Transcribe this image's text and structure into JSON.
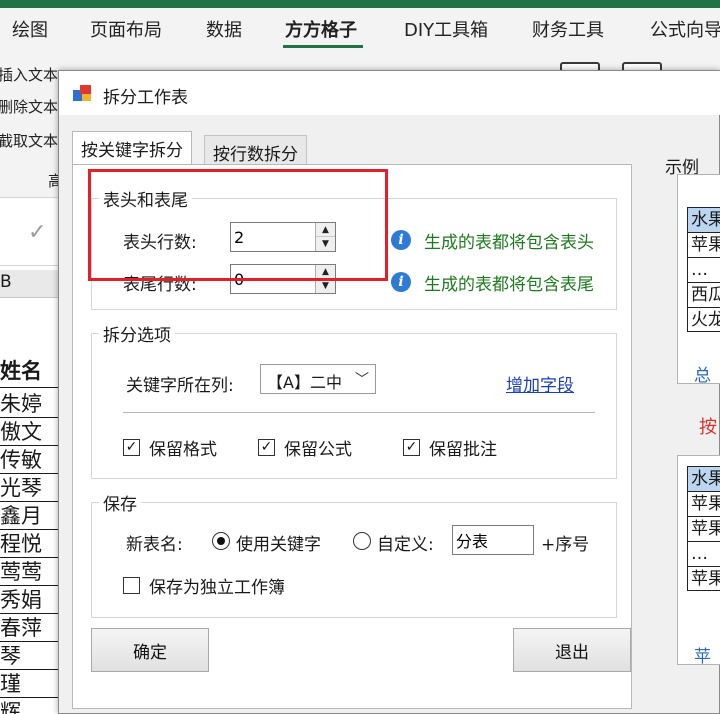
{
  "ribbon": {
    "tabs": [
      "绘图",
      "页面布局",
      "数据",
      "方方格子",
      "DIY工具箱",
      "财务工具",
      "公式向导"
    ],
    "active_tab": "方方格子",
    "left_items": [
      "插入文本",
      "删除文本",
      "截取文本"
    ],
    "group_label": "高",
    "accent_color": "#217346"
  },
  "sheet": {
    "column_header": "B",
    "header_cell": "姓名",
    "cells": [
      "朱婷",
      "傲文",
      "传敏",
      "光琴",
      "鑫月",
      "程悦",
      "莺莺",
      "秀娟",
      "春萍",
      "琴",
      "瑾",
      "辉"
    ]
  },
  "dialog": {
    "title": "拆分工作表",
    "tabs": [
      "按关键字拆分",
      "按行数拆分"
    ],
    "header_footer": {
      "group_label": "表头和表尾",
      "header_rows_label": "表头行数:",
      "header_rows_value": "2",
      "footer_rows_label": "表尾行数:",
      "footer_rows_value": "0",
      "header_hint": "生成的表都将包含表头",
      "footer_hint": "生成的表都将包含表尾"
    },
    "split_options": {
      "group_label": "拆分选项",
      "key_column_label": "关键字所在列:",
      "key_column_value": "【A】二中",
      "add_field_link": "增加字段",
      "keep_format": "保留格式",
      "keep_formula": "保留公式",
      "keep_comment": "保留批注"
    },
    "save": {
      "group_label": "保存",
      "sheet_name_label": "新表名:",
      "use_keyword": "使用关键字",
      "custom_label": "自定义:",
      "custom_value": "分表",
      "suffix": "+序号",
      "save_independent": "保存为独立工作簿"
    },
    "ok_button": "确定",
    "exit_button": "退出",
    "example": {
      "label": "示例",
      "top_cells": [
        "水果",
        "苹果",
        "…",
        "西瓜",
        "火龙"
      ],
      "top_tab": "总",
      "arrow_text": "按",
      "bottom_cells": [
        "水果",
        "苹果",
        "苹果",
        "…",
        "苹果"
      ],
      "bottom_tab": "苹"
    }
  },
  "highlight_color": "#e21f2b"
}
